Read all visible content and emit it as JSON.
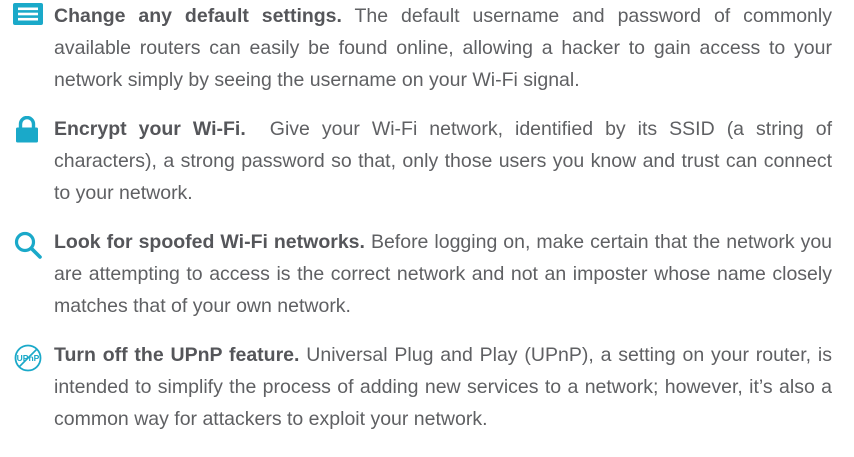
{
  "colors": {
    "accent": "#1aa9c9",
    "text": "#5f6063"
  },
  "tips": [
    {
      "icon": "list-icon",
      "lead": "Change any default settings.",
      "body": "The default username and password of commonly available routers can easily be found online, allowing a hacker to gain access to your network simply by seeing the username on your Wi-Fi signal."
    },
    {
      "icon": "lock-icon",
      "lead": "Encrypt your Wi-Fi.",
      "body": "Give your Wi-Fi network, identified by its SSID (a string of characters), a strong password so that, only those users you know and trust can connect to your network."
    },
    {
      "icon": "search-icon",
      "lead": "Look for spoofed Wi-Fi networks.",
      "body": "Before logging on, make certain that the network you are attempting to access is the correct network and not an imposter whose name closely matches that of your own network."
    },
    {
      "icon": "upnp-disabled-icon",
      "icon_text": "UPnP",
      "lead": "Turn off the UPnP feature.",
      "body": "Universal Plug and Play (UPnP), a setting on your router, is intended to simplify the process of adding new services to a network; however, it’s also a common way for attackers to exploit your network."
    }
  ]
}
